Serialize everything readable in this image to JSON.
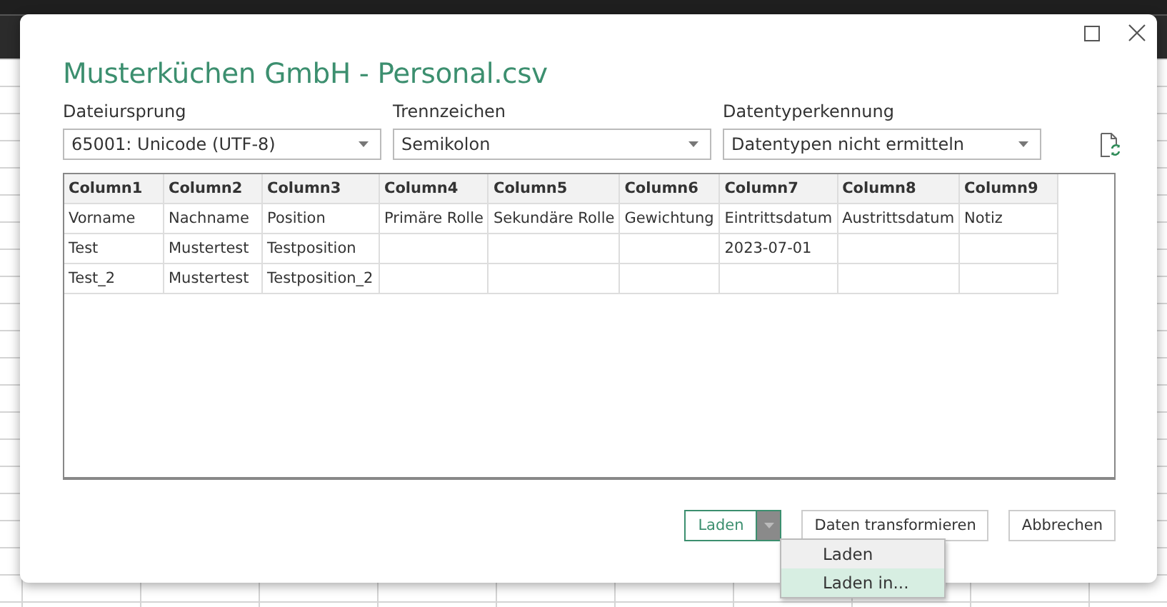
{
  "dialog": {
    "title": "Musterküchen GmbH - Personal.csv"
  },
  "fields": [
    {
      "label": "Dateiursprung",
      "value": "65001: Unicode (UTF-8)"
    },
    {
      "label": "Trennzeichen",
      "value": "Semikolon"
    },
    {
      "label": "Datentyperkennung",
      "value": "Datentypen nicht ermitteln"
    }
  ],
  "table": {
    "columns": [
      "Column1",
      "Column2",
      "Column3",
      "Column4",
      "Column5",
      "Column6",
      "Column7",
      "Column8",
      "Column9"
    ],
    "rows": [
      [
        "Vorname",
        "Nachname",
        "Position",
        "Primäre Rolle",
        "Sekundäre Rolle",
        "Gewichtung",
        "Eintrittsdatum",
        "Austrittsdatum",
        "Notiz"
      ],
      [
        "Test",
        "Mustertest",
        "Testposition",
        "",
        "",
        "",
        "2023-07-01",
        "",
        ""
      ],
      [
        "Test_2",
        "Mustertest",
        "Testposition_2",
        "",
        "",
        "",
        "",
        "",
        ""
      ]
    ]
  },
  "buttons": [
    {
      "label": "Laden",
      "kind": "split"
    },
    {
      "label": "Daten transformieren",
      "kind": "plain"
    },
    {
      "label": "Abbrechen",
      "kind": "plain"
    }
  ],
  "menu": [
    {
      "label": "Laden",
      "selected": false
    },
    {
      "label": "Laden in...",
      "selected": true
    }
  ]
}
